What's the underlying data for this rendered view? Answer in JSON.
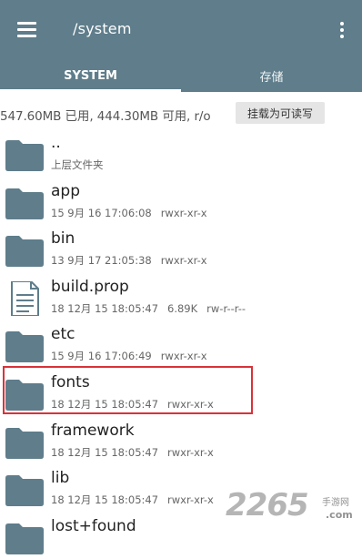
{
  "header": {
    "title": "/system"
  },
  "tabs": [
    {
      "label": "SYSTEM",
      "active": true
    },
    {
      "label": "存储",
      "active": false
    }
  ],
  "storage_info": {
    "usage": "547.60MB 已用, 444.30MB 可用, r/o",
    "mount_button": "挂载为可读写"
  },
  "files": [
    {
      "name": "..",
      "meta": [
        "上层文件夹"
      ],
      "icon": "folder-icon"
    },
    {
      "name": "app",
      "meta": [
        "15 9月 16 17:06:08",
        "rwxr-xr-x"
      ],
      "icon": "folder-icon"
    },
    {
      "name": "bin",
      "meta": [
        "13 9月 17 21:05:38",
        "rwxr-xr-x"
      ],
      "icon": "folder-icon"
    },
    {
      "name": "build.prop",
      "meta": [
        "18 12月 15 18:05:47",
        "6.89K",
        "rw-r--r--"
      ],
      "icon": "document-icon"
    },
    {
      "name": "etc",
      "meta": [
        "15 9月 16 17:06:49",
        "rwxr-xr-x"
      ],
      "icon": "folder-icon"
    },
    {
      "name": "fonts",
      "meta": [
        "18 12月 15 18:05:47",
        "rwxr-xr-x"
      ],
      "icon": "folder-icon"
    },
    {
      "name": "framework",
      "meta": [
        "18 12月 15 18:05:47",
        "rwxr-xr-x"
      ],
      "icon": "folder-icon"
    },
    {
      "name": "lib",
      "meta": [
        "18 12月 15 18:05:47",
        "rwxr-xr-x"
      ],
      "icon": "folder-icon"
    },
    {
      "name": "lost+found",
      "meta": [],
      "icon": "folder-icon"
    }
  ],
  "colors": {
    "appbar": "#5f7d8b",
    "folder": "#5f7d8b",
    "highlight": "#d9323a"
  },
  "watermark": {
    "digits": "2265",
    "site": "手游网",
    "domain": ".com"
  }
}
